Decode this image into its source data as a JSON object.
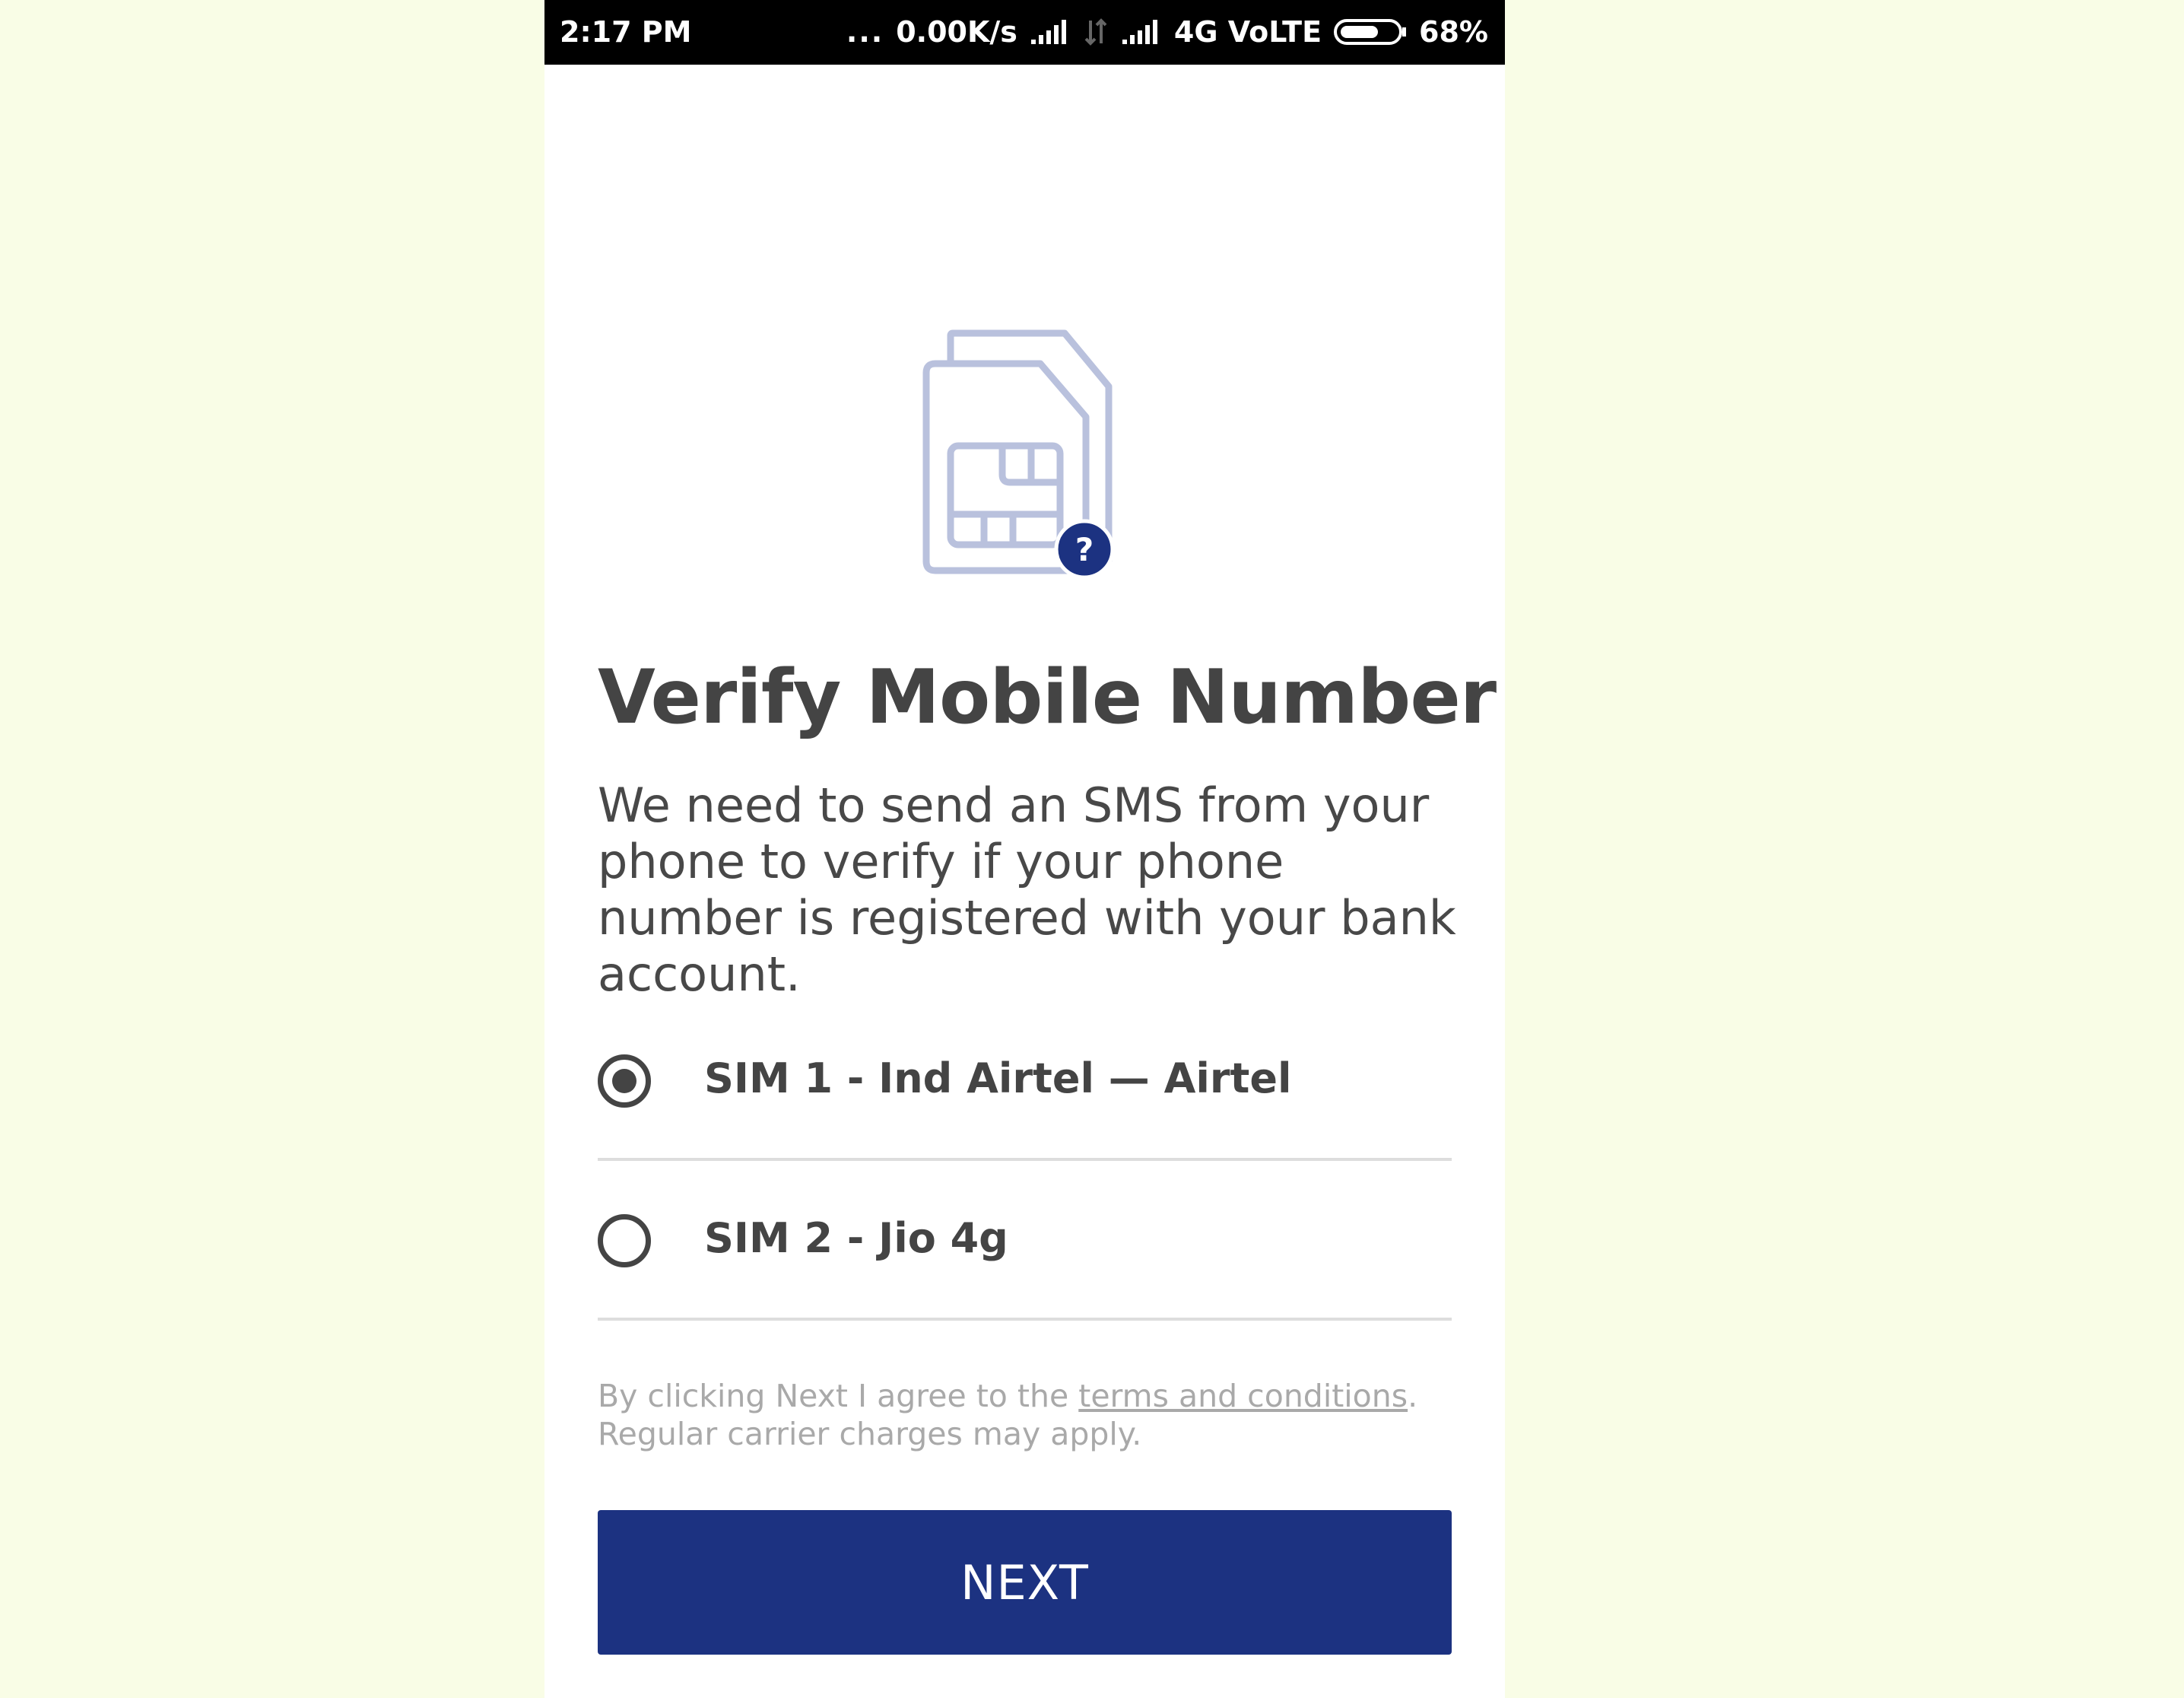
{
  "status_bar": {
    "time": "2:17 PM",
    "dots": "...",
    "network_speed": "0.00K/s",
    "network_type": "4G VoLTE",
    "battery_level": 0.68,
    "battery_percent": "68%",
    "icons": [
      "signal-icon-sim1",
      "data-transfer-icon",
      "signal-icon-sim2",
      "battery-icon"
    ]
  },
  "sim_graphic": {
    "icon": "sim-card-icon",
    "badge": "?",
    "badge_color": "#1c3281",
    "icon_color": "#b9c1dd"
  },
  "title": "Verify Mobile Number",
  "description": "We need to send an SMS from your phone to verify if your phone number is registered with your bank account.",
  "sim_options": [
    {
      "label": "SIM 1 - Ind Airtel — Airtel",
      "selected": true
    },
    {
      "label": "SIM 2 - Jio 4g",
      "selected": false
    }
  ],
  "terms": {
    "prefix": "By clicking Next I agree to the ",
    "link": "terms and conditions",
    "suffix": ".",
    "line2": "Regular carrier charges may apply."
  },
  "next_button": {
    "label": "NEXT",
    "color": "#1c3281"
  },
  "colors": {
    "page_background": "#f9fde6",
    "accent": "#1c3281",
    "text": "#444444",
    "muted_text": "#a9a9a9"
  }
}
